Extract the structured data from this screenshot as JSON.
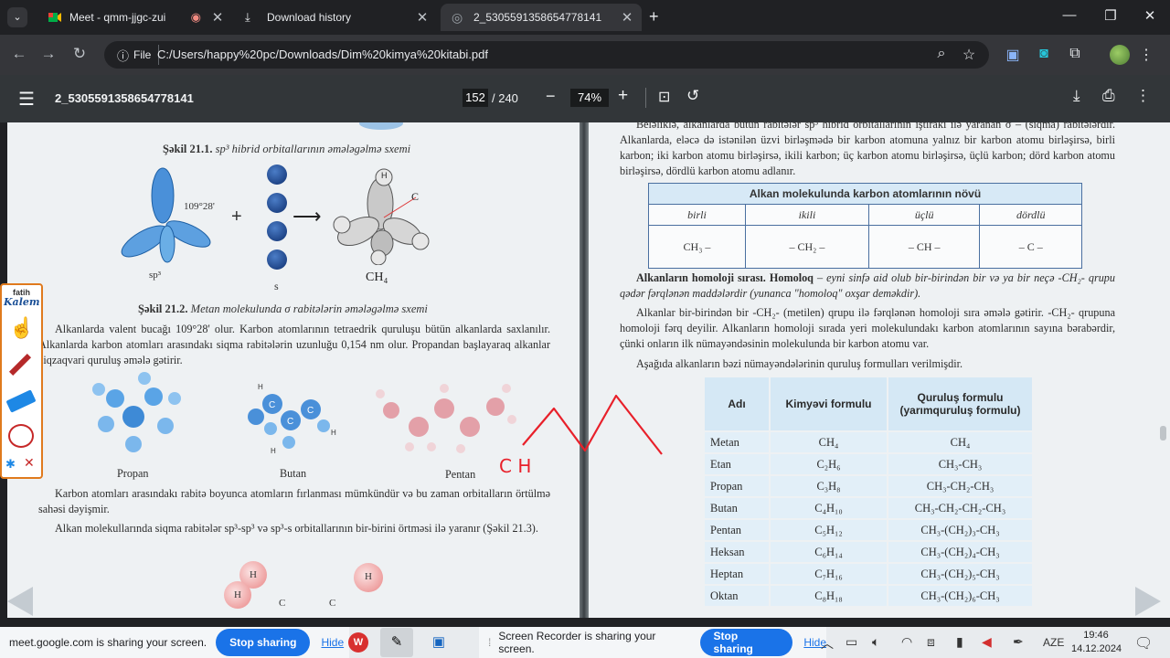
{
  "tabs": [
    {
      "title": "Meet - qmm-jjgc-zui",
      "active": false
    },
    {
      "title": "Download history",
      "active": false
    },
    {
      "title": "2_5305591358654778141",
      "active": true
    }
  ],
  "address": {
    "scheme_label": "File",
    "url": "C:/Users/happy%20pc/Downloads/Dim%20kimya%20kitabi.pdf"
  },
  "pdf": {
    "doc_title": "2_5305591358654778141",
    "page": "152",
    "total": "/ 240",
    "zoom": "74%"
  },
  "left_page": {
    "fig1_caption_bold": "Şəkil 21.1.",
    "fig1_caption_italic": " sp³ hibrid orbitallarının əmələgəlmə sxemi",
    "angle": "109°28'",
    "label_sp3": "sp³",
    "label_s": "s",
    "label_ch4": "CH₄",
    "label_c": "C",
    "label_h": "H",
    "fig2_caption_bold": "Şəkil 21.2.",
    "fig2_caption_italic": " Metan molekulunda σ rabitələrin əmələgəlmə sxemi",
    "para1": "Alkanlarda valent bucağı 109°28' olur. Karbon atomlarının tetraedrik quruluşu bütün alkanlarda saxlanılır. Alkanlarda karbon atomları arasındakı siqma rabitələrin uzunluğu 0,154 nm olur. Propandan başlayaraq alkanlar ziqzaqvari quruluş əmələ gətirir.",
    "mol_labels": [
      "Propan",
      "Butan",
      "Pentan"
    ],
    "para2": "Karbon atomları arasındakı rabitə boyunca atomların fırlanması mümkündür və bu zaman orbitalların örtülmə sahəsi dəyişmir.",
    "para3": "Alkan molekullarında siqma rabitələr sp³-sp³ və sp³-s orbitallarının bir-birini örtməsi ilə yaranır (Şəkil 21.3).",
    "hand_text": "C H",
    "orb_labels": [
      "H",
      "H",
      "H",
      "C",
      "C"
    ]
  },
  "right_page": {
    "top_text": "Beləliklə, alkanlarda bütün rabitələr sp³ hibrid orbitallarının iştirakı ilə yaranan σ – (siqma) rabitələrdir. Alkanlarda, eləcə də istənilən üzvi birləşmədə bir karbon atomuna yalnız bir karbon atomu birləşirsə, birli karbon; iki karbon atomu birləşirsə, ikili karbon; üç karbon atomu birləşirsə, üçlü karbon; dörd karbon atomu birləşirsə, dördlü karbon atomu adlanır.",
    "table1_title": "Alkan molekulunda karbon atomlarının növü",
    "table1_headers": [
      "birli",
      "ikili",
      "üçlü",
      "dördlü"
    ],
    "table1_cells": [
      "CH₃ –",
      "– CH₂ –",
      "– CH –",
      "– C –"
    ],
    "homolog_bold": "Alkanların homoloji sırası. Homoloq",
    "homolog_rest": " – eyni sinfə aid olub bir-birindən bir və ya bir neçə -CH₂- qrupu qədər fərqlənən maddələrdir (yunanca \"homoloq\" oxşar deməkdir).",
    "para_b": "Alkanlar bir-birindən bir -CH₂- (metilen) qrupu ilə fərqlənən homoloji sıra əmələ gətirir. -CH₂- qrupuna homoloji fərq deyilir. Alkanların homoloji sırada yeri molekulundakı karbon atomlarının sayına bərabərdir, çünki onların ilk nümayəndəsinin molekulunda bir karbon atomu var.",
    "para_c": "Aşağıda alkanların bəzi nümayəndələrinin quruluş formulları verilmişdir.",
    "table2_headers": [
      "Adı",
      "Kimyəvi formulu",
      "Quruluş formulu (yarımquruluş formulu)"
    ],
    "table2_rows": [
      [
        "Metan",
        "CH₄",
        "CH₄"
      ],
      [
        "Etan",
        "C₂H₆",
        "CH₃-CH₃"
      ],
      [
        "Propan",
        "C₃H₈",
        "CH₃-CH₂-CH₃"
      ],
      [
        "Butan",
        "C₄H₁₀",
        "CH₃-CH₂-CH₂-CH₃"
      ],
      [
        "Pentan",
        "C₅H₁₂",
        "CH₃-(CH₂)₃-CH₃"
      ],
      [
        "Heksan",
        "C₆H₁₄",
        "CH₃-(CH₂)₄-CH₃"
      ],
      [
        "Heptan",
        "C₇H₁₆",
        "CH₃-(CH₂)₅-CH₃"
      ],
      [
        "Oktan",
        "C₈H₁₈",
        "CH₃-(CH₂)₆-CH₃"
      ]
    ]
  },
  "fatih": {
    "line1": "fatih",
    "line2": "Kalem"
  },
  "bottom": {
    "share1": "meet.google.com is sharing your screen.",
    "stop": "Stop sharing",
    "hide": "Hide",
    "share2": "Screen Recorder is sharing your screen.",
    "lang": "AZE",
    "time": "19:46",
    "date": "14.12.2024"
  },
  "colors": {
    "accent": "#1a73e8",
    "pen": "#e8202a",
    "fatih_border": "#e07a1d"
  }
}
